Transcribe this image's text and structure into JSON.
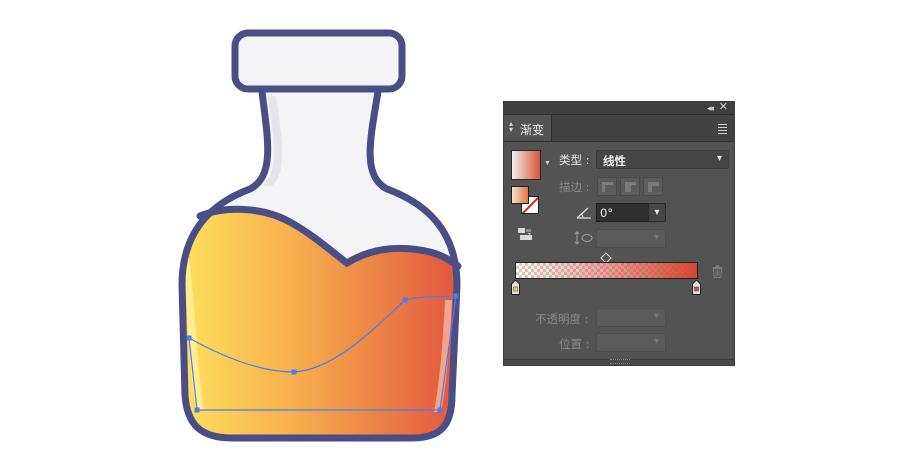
{
  "artwork": {
    "outline_color": "#4a4e85",
    "glass_color": "#f4f4f6",
    "liquid_gradient": [
      "#fddf5c",
      "#f5a84c",
      "#e2563e"
    ],
    "selection_color": "#4a7cf0"
  },
  "gradient_panel": {
    "tab_title": "渐变",
    "type_label": "类型",
    "type_value": "线性",
    "stroke_label": "描边",
    "angle_value": "0°",
    "opacity_label": "不透明度",
    "location_label": "位置",
    "ramp_colors": [
      "#f0dcc8",
      "#d7463a"
    ],
    "icons": {
      "collapse": "double-chevron-left-icon",
      "close": "close-x-icon",
      "tab_arrows": "up-down-arrows-icon",
      "menu": "hamburger-menu-icon",
      "reverse": "reverse-gradient-icon",
      "angle": "angle-icon",
      "aspect": "aspect-ratio-icon",
      "trash": "trash-icon"
    }
  }
}
